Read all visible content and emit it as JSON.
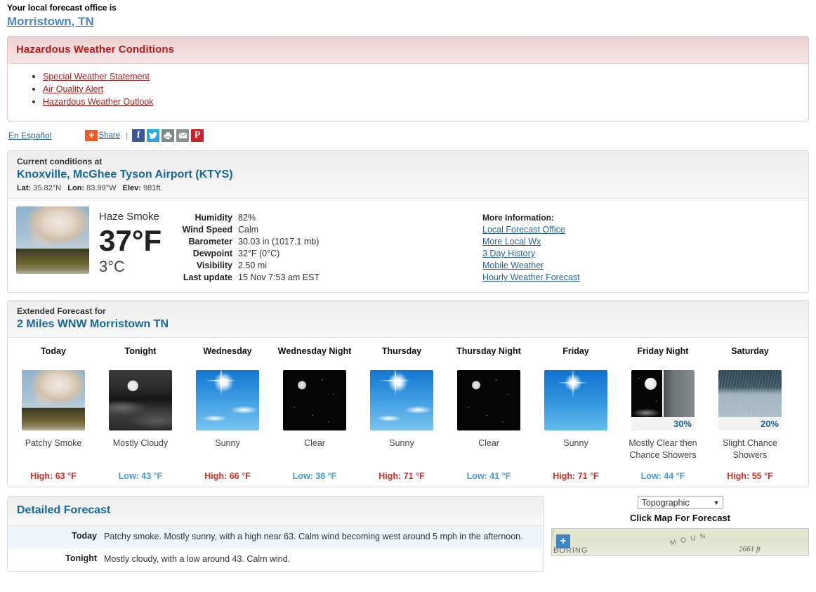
{
  "office": {
    "label": "Your local forecast office is",
    "name": "Morristown, TN"
  },
  "hazards": {
    "title": "Hazardous Weather Conditions",
    "items": [
      "Special Weather Statement",
      "Air Quality Alert",
      "Hazardous Weather Outlook"
    ]
  },
  "share": {
    "espanol": "En Español",
    "plus": "+",
    "share_label": "Share",
    "separator": "|",
    "facebook": "f",
    "twitter": "t",
    "print": "p",
    "email": "e",
    "pinterest": "P"
  },
  "current": {
    "heading": "Current conditions at",
    "station": "Knoxville, McGhee Tyson Airport (KTYS)",
    "lat_label": "Lat:",
    "lat": "35.82°N",
    "lon_label": "Lon:",
    "lon": "83.99°W",
    "elev_label": "Elev:",
    "elev": "981ft.",
    "condition": "Haze Smoke",
    "temp_f": "37°F",
    "temp_c": "3°C",
    "icon": "smoke-photo-icon",
    "details": [
      {
        "key": "Humidity",
        "value": "82%"
      },
      {
        "key": "Wind Speed",
        "value": "Calm"
      },
      {
        "key": "Barometer",
        "value": "30.03 in (1017.1 mb)"
      },
      {
        "key": "Dewpoint",
        "value": "32°F (0°C)"
      },
      {
        "key": "Visibility",
        "value": "2.50 mi"
      },
      {
        "key": "Last update",
        "value": "15 Nov 7:53 am EST"
      }
    ],
    "more_info_heading": "More Information:",
    "more_info_links": [
      "Local Forecast Office",
      "More Local Wx",
      "3 Day History",
      "Mobile Weather",
      "Hourly Weather Forecast"
    ]
  },
  "extended": {
    "heading": "Extended Forecast for",
    "location": "2 Miles WNW Morristown TN",
    "periods": [
      {
        "day": "Today",
        "icon": "smoke-photo-icon",
        "icon_class": "ic-smoke",
        "condition": "Patchy Smoke",
        "temp_label": "High: 63 °F",
        "temp_type": "high",
        "pop": ""
      },
      {
        "day": "Tonight",
        "icon": "mostly-cloudy-night-icon",
        "icon_class": "ic-mcloudy-n",
        "condition": "Mostly Cloudy",
        "temp_label": "Low: 43 °F",
        "temp_type": "low",
        "pop": ""
      },
      {
        "day": "Wednesday",
        "icon": "sunny-icon",
        "icon_class": "ic-sunny-cl",
        "condition": "Sunny",
        "temp_label": "High: 66 °F",
        "temp_type": "high",
        "pop": ""
      },
      {
        "day": "Wednesday\nNight",
        "icon": "clear-night-icon",
        "icon_class": "ic-clear-n",
        "condition": "Clear",
        "temp_label": "Low: 38 °F",
        "temp_type": "low",
        "pop": ""
      },
      {
        "day": "Thursday",
        "icon": "sunny-icon",
        "icon_class": "ic-sunny-cl",
        "condition": "Sunny",
        "temp_label": "High: 71 °F",
        "temp_type": "high",
        "pop": ""
      },
      {
        "day": "Thursday\nNight",
        "icon": "clear-night-icon",
        "icon_class": "ic-clear-n",
        "condition": "Clear",
        "temp_label": "Low: 41 °F",
        "temp_type": "low",
        "pop": ""
      },
      {
        "day": "Friday",
        "icon": "sunny-icon",
        "icon_class": "ic-sunny",
        "condition": "Sunny",
        "temp_label": "High: 71 °F",
        "temp_type": "high",
        "pop": ""
      },
      {
        "day": "Friday\nNight",
        "icon": "mostly-clear-then-showers-icon",
        "icon_class": "ic-split-n",
        "condition": "Mostly Clear then Chance Showers",
        "temp_label": "Low: 44 °F",
        "temp_type": "low",
        "pop": "30%"
      },
      {
        "day": "Saturday",
        "icon": "chance-showers-icon",
        "icon_class": "ic-showers",
        "condition": "Slight Chance Showers",
        "temp_label": "High: 55 °F",
        "temp_type": "high",
        "pop": "20%"
      }
    ]
  },
  "detailed": {
    "title": "Detailed Forecast",
    "rows": [
      {
        "period": "Today",
        "text": "Patchy smoke. Mostly sunny, with a high near 63. Calm wind becoming west around 5 mph in the afternoon."
      },
      {
        "period": "Tonight",
        "text": "Mostly cloudy, with a low around 43. Calm wind."
      }
    ]
  },
  "map": {
    "select_value": "Topographic",
    "caret": "▼",
    "click_label": "Click Map For Forecast",
    "zoom_in": "+",
    "elevation_label": "2661 ft",
    "town_label": "BORING",
    "ridge_label": "M O U N"
  },
  "colors": {
    "link": "#2a6496",
    "heading_blue": "#16679a",
    "hazard_red": "#b81b18",
    "high_temp": "#e0271c",
    "low_temp": "#3f9bdc",
    "pop_blue": "#16679a"
  }
}
